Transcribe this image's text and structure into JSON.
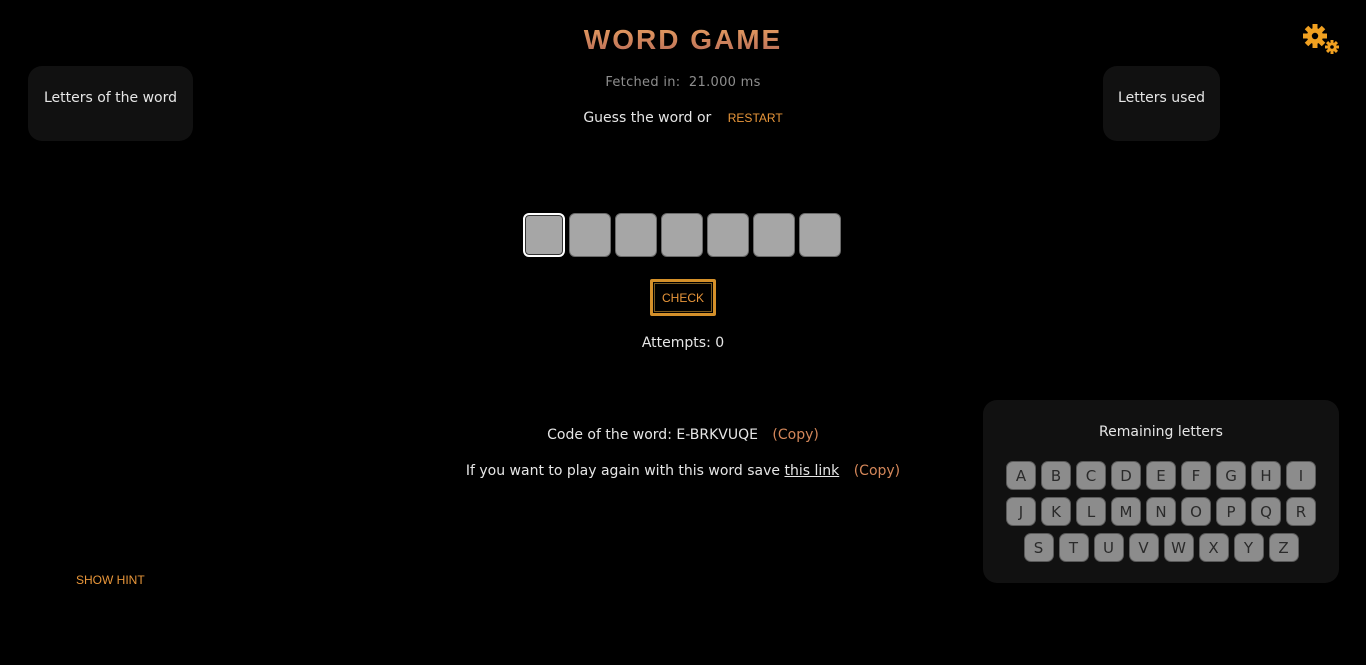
{
  "header": {
    "title": "WORD GAME",
    "fetched_label": "Fetched in:",
    "fetched_value": "21.000 ms",
    "guess_text": "Guess the word or",
    "restart_label": "RESTART"
  },
  "panels": {
    "word_letters_label": "Letters of the word",
    "used_letters_label": "Letters used"
  },
  "game": {
    "word_length": 7,
    "check_label": "CHECK",
    "attempts_text": "Attempts: 0"
  },
  "code": {
    "label": "Code of the word: E-BRKVUQE",
    "copy_label": "(Copy)"
  },
  "replay": {
    "text": "If you want to play again with this word save",
    "link_label": "this link",
    "copy_label": "(Copy)"
  },
  "hint_label": "SHOW HINT",
  "remaining": {
    "title": "Remaining letters",
    "rows": [
      [
        "A",
        "B",
        "C",
        "D",
        "E",
        "F",
        "G",
        "H",
        "I"
      ],
      [
        "J",
        "K",
        "L",
        "M",
        "N",
        "O",
        "P",
        "Q",
        "R"
      ],
      [
        "S",
        "T",
        "U",
        "V",
        "W",
        "X",
        "Y",
        "Z"
      ]
    ]
  },
  "icons": {
    "settings": "gear-icon"
  },
  "colors": {
    "accent": "#e8963a",
    "title": "#d4875a",
    "panel": "#111111",
    "tile": "#a6a6a6"
  }
}
